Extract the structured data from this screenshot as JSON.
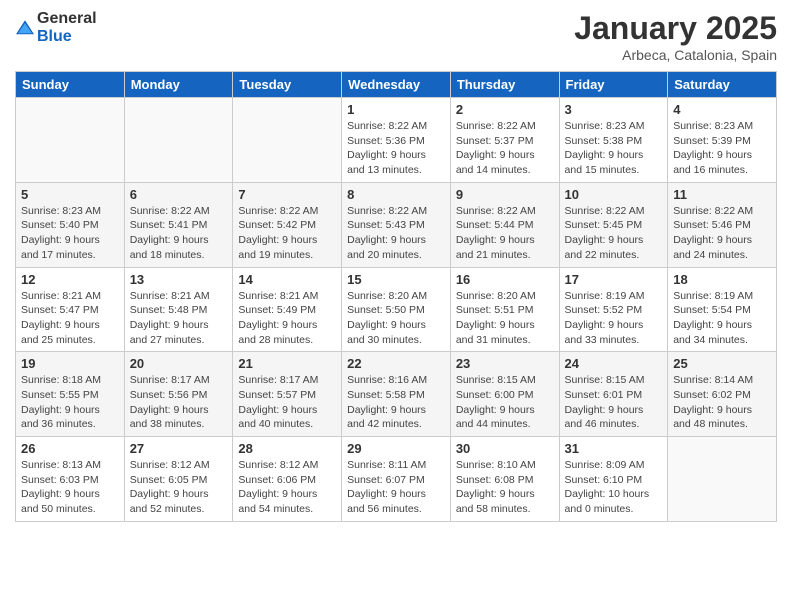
{
  "logo": {
    "general": "General",
    "blue": "Blue"
  },
  "header": {
    "month": "January 2025",
    "location": "Arbeca, Catalonia, Spain"
  },
  "weekdays": [
    "Sunday",
    "Monday",
    "Tuesday",
    "Wednesday",
    "Thursday",
    "Friday",
    "Saturday"
  ],
  "weeks": [
    [
      {
        "day": "",
        "sunrise": "",
        "sunset": "",
        "daylight": ""
      },
      {
        "day": "",
        "sunrise": "",
        "sunset": "",
        "daylight": ""
      },
      {
        "day": "",
        "sunrise": "",
        "sunset": "",
        "daylight": ""
      },
      {
        "day": "1",
        "sunrise": "Sunrise: 8:22 AM",
        "sunset": "Sunset: 5:36 PM",
        "daylight": "Daylight: 9 hours and 13 minutes."
      },
      {
        "day": "2",
        "sunrise": "Sunrise: 8:22 AM",
        "sunset": "Sunset: 5:37 PM",
        "daylight": "Daylight: 9 hours and 14 minutes."
      },
      {
        "day": "3",
        "sunrise": "Sunrise: 8:23 AM",
        "sunset": "Sunset: 5:38 PM",
        "daylight": "Daylight: 9 hours and 15 minutes."
      },
      {
        "day": "4",
        "sunrise": "Sunrise: 8:23 AM",
        "sunset": "Sunset: 5:39 PM",
        "daylight": "Daylight: 9 hours and 16 minutes."
      }
    ],
    [
      {
        "day": "5",
        "sunrise": "Sunrise: 8:23 AM",
        "sunset": "Sunset: 5:40 PM",
        "daylight": "Daylight: 9 hours and 17 minutes."
      },
      {
        "day": "6",
        "sunrise": "Sunrise: 8:22 AM",
        "sunset": "Sunset: 5:41 PM",
        "daylight": "Daylight: 9 hours and 18 minutes."
      },
      {
        "day": "7",
        "sunrise": "Sunrise: 8:22 AM",
        "sunset": "Sunset: 5:42 PM",
        "daylight": "Daylight: 9 hours and 19 minutes."
      },
      {
        "day": "8",
        "sunrise": "Sunrise: 8:22 AM",
        "sunset": "Sunset: 5:43 PM",
        "daylight": "Daylight: 9 hours and 20 minutes."
      },
      {
        "day": "9",
        "sunrise": "Sunrise: 8:22 AM",
        "sunset": "Sunset: 5:44 PM",
        "daylight": "Daylight: 9 hours and 21 minutes."
      },
      {
        "day": "10",
        "sunrise": "Sunrise: 8:22 AM",
        "sunset": "Sunset: 5:45 PM",
        "daylight": "Daylight: 9 hours and 22 minutes."
      },
      {
        "day": "11",
        "sunrise": "Sunrise: 8:22 AM",
        "sunset": "Sunset: 5:46 PM",
        "daylight": "Daylight: 9 hours and 24 minutes."
      }
    ],
    [
      {
        "day": "12",
        "sunrise": "Sunrise: 8:21 AM",
        "sunset": "Sunset: 5:47 PM",
        "daylight": "Daylight: 9 hours and 25 minutes."
      },
      {
        "day": "13",
        "sunrise": "Sunrise: 8:21 AM",
        "sunset": "Sunset: 5:48 PM",
        "daylight": "Daylight: 9 hours and 27 minutes."
      },
      {
        "day": "14",
        "sunrise": "Sunrise: 8:21 AM",
        "sunset": "Sunset: 5:49 PM",
        "daylight": "Daylight: 9 hours and 28 minutes."
      },
      {
        "day": "15",
        "sunrise": "Sunrise: 8:20 AM",
        "sunset": "Sunset: 5:50 PM",
        "daylight": "Daylight: 9 hours and 30 minutes."
      },
      {
        "day": "16",
        "sunrise": "Sunrise: 8:20 AM",
        "sunset": "Sunset: 5:51 PM",
        "daylight": "Daylight: 9 hours and 31 minutes."
      },
      {
        "day": "17",
        "sunrise": "Sunrise: 8:19 AM",
        "sunset": "Sunset: 5:52 PM",
        "daylight": "Daylight: 9 hours and 33 minutes."
      },
      {
        "day": "18",
        "sunrise": "Sunrise: 8:19 AM",
        "sunset": "Sunset: 5:54 PM",
        "daylight": "Daylight: 9 hours and 34 minutes."
      }
    ],
    [
      {
        "day": "19",
        "sunrise": "Sunrise: 8:18 AM",
        "sunset": "Sunset: 5:55 PM",
        "daylight": "Daylight: 9 hours and 36 minutes."
      },
      {
        "day": "20",
        "sunrise": "Sunrise: 8:17 AM",
        "sunset": "Sunset: 5:56 PM",
        "daylight": "Daylight: 9 hours and 38 minutes."
      },
      {
        "day": "21",
        "sunrise": "Sunrise: 8:17 AM",
        "sunset": "Sunset: 5:57 PM",
        "daylight": "Daylight: 9 hours and 40 minutes."
      },
      {
        "day": "22",
        "sunrise": "Sunrise: 8:16 AM",
        "sunset": "Sunset: 5:58 PM",
        "daylight": "Daylight: 9 hours and 42 minutes."
      },
      {
        "day": "23",
        "sunrise": "Sunrise: 8:15 AM",
        "sunset": "Sunset: 6:00 PM",
        "daylight": "Daylight: 9 hours and 44 minutes."
      },
      {
        "day": "24",
        "sunrise": "Sunrise: 8:15 AM",
        "sunset": "Sunset: 6:01 PM",
        "daylight": "Daylight: 9 hours and 46 minutes."
      },
      {
        "day": "25",
        "sunrise": "Sunrise: 8:14 AM",
        "sunset": "Sunset: 6:02 PM",
        "daylight": "Daylight: 9 hours and 48 minutes."
      }
    ],
    [
      {
        "day": "26",
        "sunrise": "Sunrise: 8:13 AM",
        "sunset": "Sunset: 6:03 PM",
        "daylight": "Daylight: 9 hours and 50 minutes."
      },
      {
        "day": "27",
        "sunrise": "Sunrise: 8:12 AM",
        "sunset": "Sunset: 6:05 PM",
        "daylight": "Daylight: 9 hours and 52 minutes."
      },
      {
        "day": "28",
        "sunrise": "Sunrise: 8:12 AM",
        "sunset": "Sunset: 6:06 PM",
        "daylight": "Daylight: 9 hours and 54 minutes."
      },
      {
        "day": "29",
        "sunrise": "Sunrise: 8:11 AM",
        "sunset": "Sunset: 6:07 PM",
        "daylight": "Daylight: 9 hours and 56 minutes."
      },
      {
        "day": "30",
        "sunrise": "Sunrise: 8:10 AM",
        "sunset": "Sunset: 6:08 PM",
        "daylight": "Daylight: 9 hours and 58 minutes."
      },
      {
        "day": "31",
        "sunrise": "Sunrise: 8:09 AM",
        "sunset": "Sunset: 6:10 PM",
        "daylight": "Daylight: 10 hours and 0 minutes."
      },
      {
        "day": "",
        "sunrise": "",
        "sunset": "",
        "daylight": ""
      }
    ]
  ]
}
